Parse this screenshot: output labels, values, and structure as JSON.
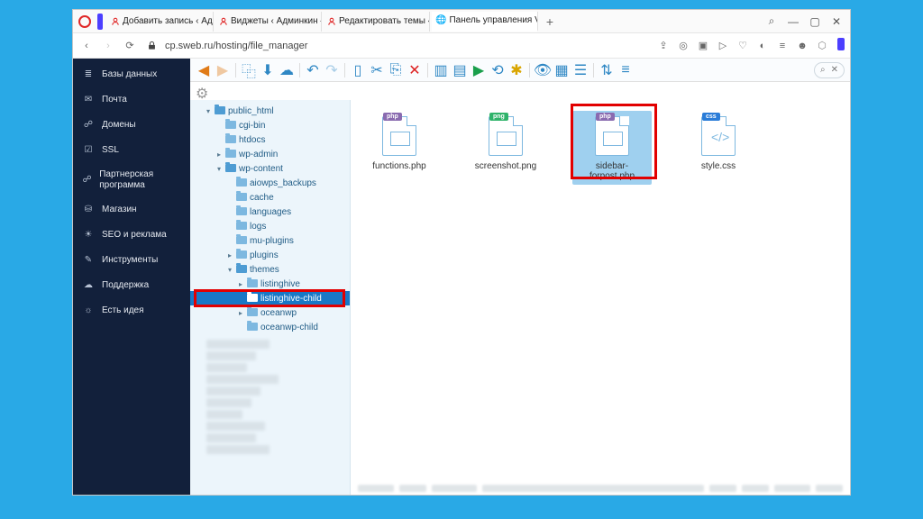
{
  "window": {
    "tabs": [
      {
        "label": "Добавить запись ‹ Адми"
      },
      {
        "label": "Виджеты ‹ Админкин —"
      },
      {
        "label": "Редактировать темы ‹ А"
      },
      {
        "label": "Панель управления VH",
        "active": true
      }
    ],
    "url": "cp.sweb.ru/hosting/file_manager"
  },
  "sidebar": {
    "items": [
      {
        "label": "Базы данных",
        "icon": "database"
      },
      {
        "label": "Почта",
        "icon": "mail"
      },
      {
        "label": "Домены",
        "icon": "sitemap"
      },
      {
        "label": "SSL",
        "icon": "shield"
      },
      {
        "label": "Партнерская программа",
        "icon": "briefcase"
      },
      {
        "label": "Магазин",
        "icon": "cart"
      },
      {
        "label": "SEO и реклама",
        "icon": "megaphone"
      },
      {
        "label": "Инструменты",
        "icon": "wrench"
      },
      {
        "label": "Поддержка",
        "icon": "chat"
      },
      {
        "label": "Есть идея",
        "icon": "bulb"
      }
    ]
  },
  "tree": {
    "items": [
      {
        "label": "public_html",
        "depth": 1,
        "open": true
      },
      {
        "label": "cgi-bin",
        "depth": 2
      },
      {
        "label": "htdocs",
        "depth": 2
      },
      {
        "label": "wp-admin",
        "depth": 2,
        "hasChildren": true
      },
      {
        "label": "wp-content",
        "depth": 2,
        "open": true
      },
      {
        "label": "aiowps_backups",
        "depth": 3
      },
      {
        "label": "cache",
        "depth": 3
      },
      {
        "label": "languages",
        "depth": 3
      },
      {
        "label": "logs",
        "depth": 3
      },
      {
        "label": "mu-plugins",
        "depth": 3
      },
      {
        "label": "plugins",
        "depth": 3,
        "hasChildren": true
      },
      {
        "label": "themes",
        "depth": 3,
        "open": true
      },
      {
        "label": "listinghive",
        "depth": 4,
        "hasChildren": true
      },
      {
        "label": "listinghive-child",
        "depth": 4,
        "selected": true
      },
      {
        "label": "oceanwp",
        "depth": 4,
        "hasChildren": true
      },
      {
        "label": "oceanwp-child",
        "depth": 4
      }
    ]
  },
  "files": {
    "items": [
      {
        "name": "functions.php",
        "type": "php"
      },
      {
        "name": "screenshot.png",
        "type": "png"
      },
      {
        "name": "sidebar-forpost.php",
        "type": "php",
        "selected": true
      },
      {
        "name": "style.css",
        "type": "css"
      }
    ]
  },
  "toolbar": {
    "search_icon": "⌕",
    "close_icon": "✕"
  }
}
